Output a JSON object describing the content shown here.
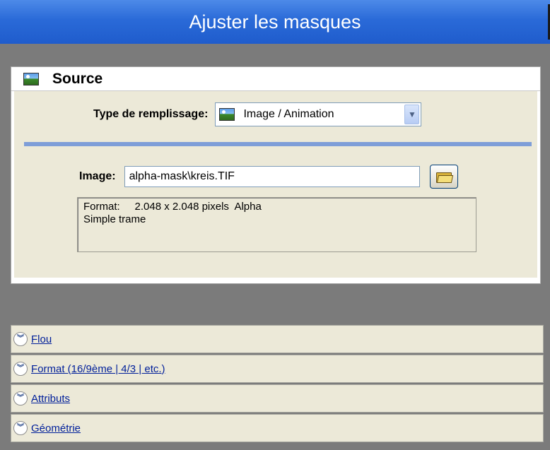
{
  "window": {
    "title": "Ajuster les masques"
  },
  "source": {
    "title": "Source",
    "header_icon": "image-icon",
    "fill_type": {
      "label": "Type de remplissage:",
      "selected": "Image / Animation",
      "icon": "image-icon"
    },
    "image": {
      "label": "Image:",
      "value": "alpha-mask\\kreis.TIF",
      "browse_icon": "folder-icon"
    },
    "info": {
      "line1": "Format:     2.048 x 2.048 pixels  Alpha",
      "line2": "Simple trame"
    }
  },
  "sections": [
    {
      "label": "Flou"
    },
    {
      "label": "Format (16/9ème | 4/3 | etc.)"
    },
    {
      "label": "Attributs"
    },
    {
      "label": "Géométrie"
    }
  ],
  "colors": {
    "titlebar": "#2a6ad8",
    "panel_bg": "#ece9d8",
    "backdrop": "#7b7b7b",
    "divider": "#7e9ed8",
    "link": "#001f9a"
  }
}
